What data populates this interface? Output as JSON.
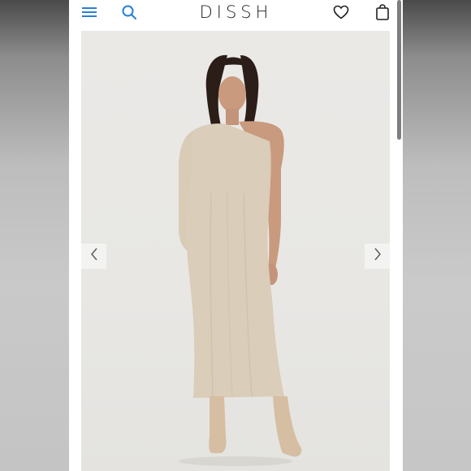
{
  "app": {
    "brand": "DISSH",
    "accent_color": "#2a7fd4"
  },
  "header": {
    "icons": [
      "menu-icon",
      "search-icon",
      "heart-icon",
      "bag-icon"
    ]
  },
  "product_image": {
    "description_icon": "product-photo",
    "prev_icon": "chevron-left-icon",
    "next_icon": "chevron-right-icon"
  }
}
